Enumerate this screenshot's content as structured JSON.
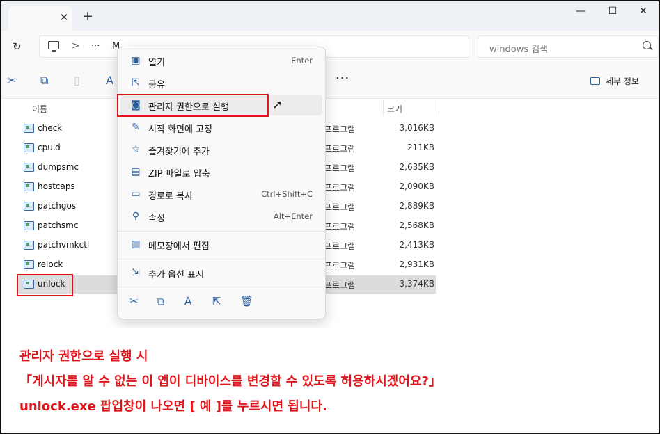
{
  "window": {
    "tab_close": "✕",
    "new_tab": "+",
    "minimize": "—",
    "maximize": "☐",
    "close": "✕"
  },
  "addressbar": {
    "refresh": "↻",
    "crumbs": [
      ">",
      "···",
      "M",
      ">"
    ],
    "search_placeholder": "windows 검색"
  },
  "toolbar": {
    "more": "···",
    "details_label": "세부 정보"
  },
  "list": {
    "headers": {
      "name": "이름",
      "size": "크기"
    },
    "files": [
      {
        "name": "check",
        "type": "프로그램",
        "size": "3,016KB"
      },
      {
        "name": "cpuid",
        "type": "프로그램",
        "size": "211KB"
      },
      {
        "name": "dumpsmc",
        "type": "프로그램",
        "size": "2,635KB"
      },
      {
        "name": "hostcaps",
        "type": "프로그램",
        "size": "2,090KB"
      },
      {
        "name": "patchgos",
        "type": "프로그램",
        "size": "2,889KB"
      },
      {
        "name": "patchsmc",
        "type": "프로그램",
        "size": "2,568KB"
      },
      {
        "name": "patchvmkctl",
        "type": "프로그램",
        "size": "2,413KB"
      },
      {
        "name": "relock",
        "type": "프로그램",
        "size": "2,931KB"
      },
      {
        "name": "unlock",
        "type": "프로그램",
        "size": "3,374KB"
      }
    ]
  },
  "context_menu": {
    "items": [
      {
        "label": "열기",
        "shortcut": "Enter",
        "icon": "open-icon"
      },
      {
        "label": "공유",
        "shortcut": "",
        "icon": "share-icon"
      },
      {
        "label": "관리자 권한으로 실행",
        "shortcut": "",
        "icon": "shield-icon"
      },
      {
        "label": "시작 화면에 고정",
        "shortcut": "",
        "icon": "pin-icon"
      },
      {
        "label": "즐겨찾기에 추가",
        "shortcut": "",
        "icon": "star-icon"
      },
      {
        "label": "ZIP 파일로 압축",
        "shortcut": "",
        "icon": "zip-folder-icon"
      },
      {
        "label": "경로로 복사",
        "shortcut": "Ctrl+Shift+C",
        "icon": "copy-path-icon"
      },
      {
        "label": "속성",
        "shortcut": "Alt+Enter",
        "icon": "wrench-icon"
      },
      {
        "label": "메모장에서 편집",
        "shortcut": "",
        "icon": "notepad-icon"
      },
      {
        "label": "추가 옵션 표시",
        "shortcut": "",
        "icon": "more-options-icon"
      }
    ]
  },
  "caption": {
    "line1": "관리자 권한으로 실행 시",
    "line2": "「게시자를 알 수 없는 이 앱이 디바이스를 변경할 수 있도록 허용하시겠어요?」",
    "line3": "unlock.exe 팝업창이 나오면 [ 예 ]를 누르시면 됩니다."
  },
  "colors": {
    "highlight_red": "#e0151b",
    "caption_red": "#e0151b",
    "accent": "#2b5f9e"
  }
}
